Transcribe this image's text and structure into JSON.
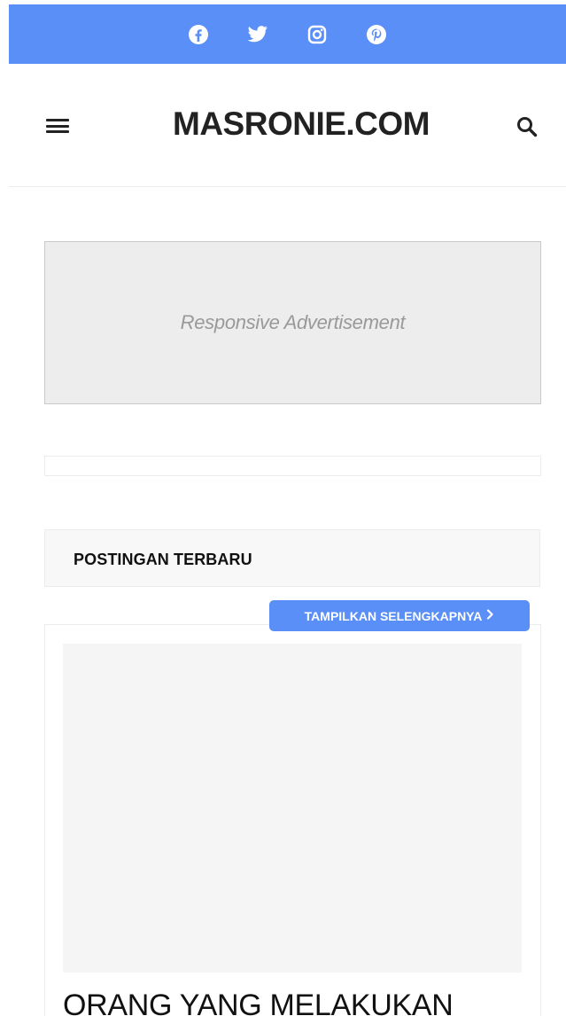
{
  "social": {
    "icons": [
      "facebook-icon",
      "twitter-icon",
      "instagram-icon",
      "pinterest-icon"
    ],
    "bar_color": "#5a8ff7"
  },
  "header": {
    "site_title": "MASRONIE.COM",
    "menu_icon": "hamburger-menu-icon",
    "search_icon": "search-icon"
  },
  "ad": {
    "text": "Responsive Advertisement"
  },
  "section": {
    "title": "POSTINGAN TERBARU",
    "more_label": "TAMPILKAN SELENGKAPNYA",
    "more_icon": "chevron-right-icon"
  },
  "post": {
    "title": "ORANG YANG MELAKUKAN"
  },
  "colors": {
    "accent": "#5a8ff7",
    "text": "#222222",
    "ad_background": "#ededed"
  }
}
